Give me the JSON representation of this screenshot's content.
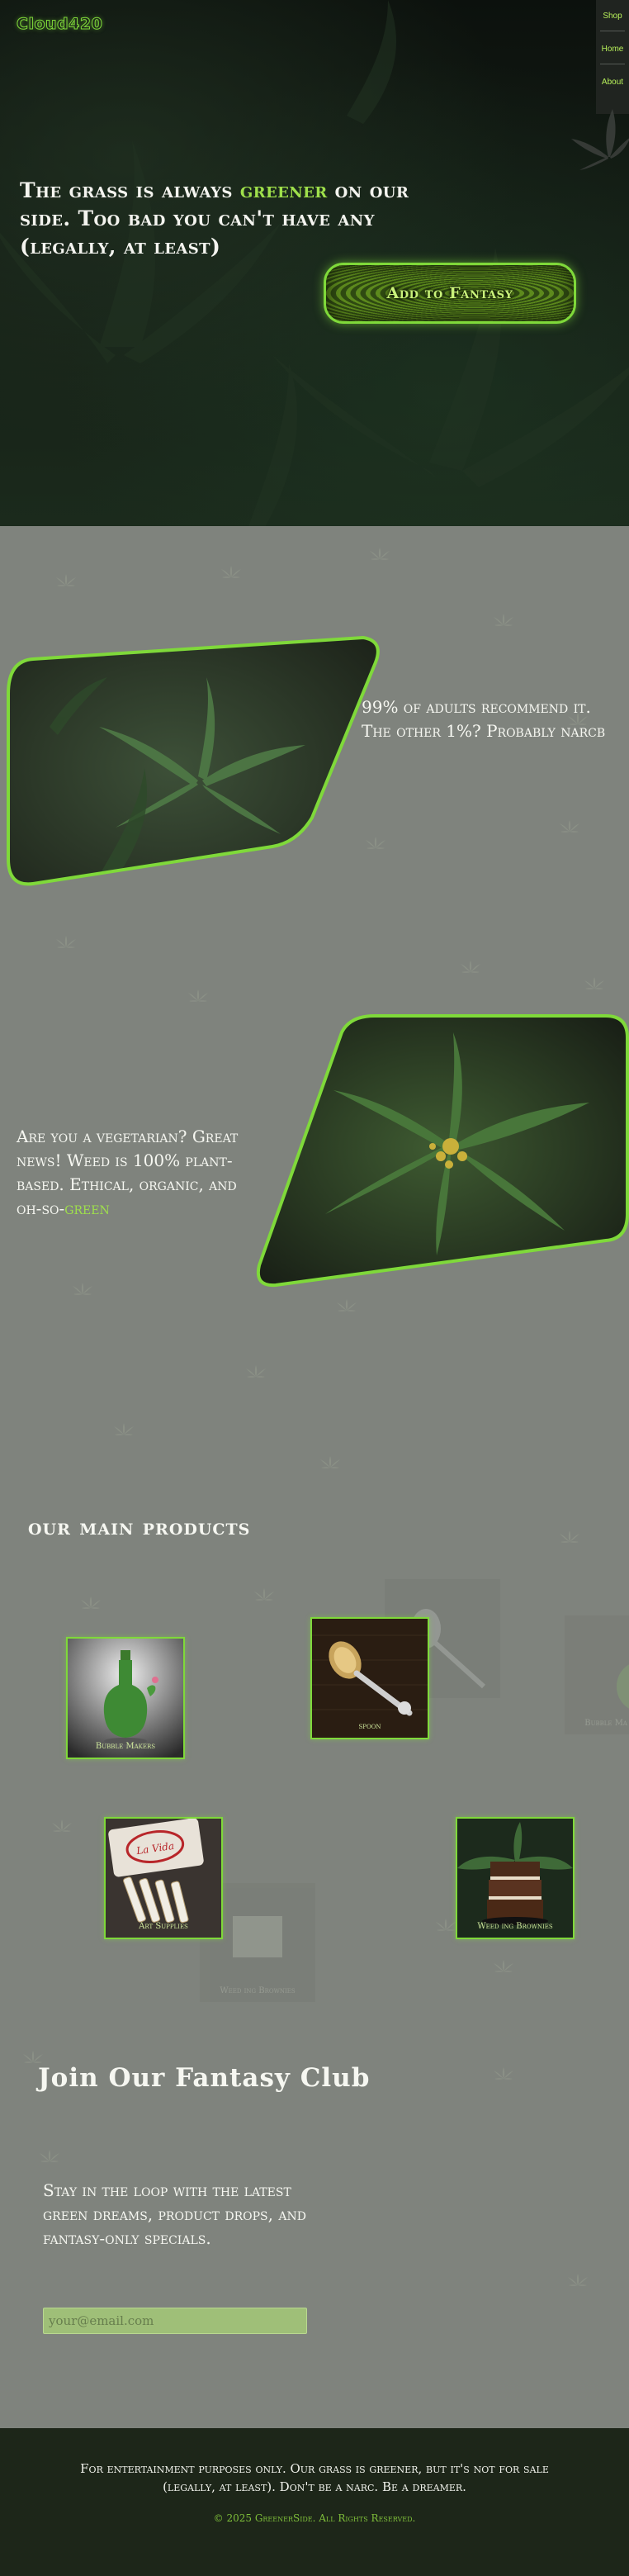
{
  "header": {
    "logo": "Cloud420",
    "nav": [
      "Shop",
      "Home",
      "About"
    ]
  },
  "hero": {
    "title_part1": "The grass is always ",
    "title_highlight": "greener",
    "title_part2": " on our side. Too bad you can't have any (legally, at least)",
    "cta_label": "Add to Fantasy"
  },
  "features": [
    {
      "text": "99% of adults recommend it. The other 1%? Probably narcb",
      "highlight": ""
    },
    {
      "text": "Are you a vegetarian? Great news! Weed is 100% plant-based. Ethical, organic, and oh-so-",
      "highlight": "green"
    }
  ],
  "products": {
    "title": "our main products",
    "items": [
      {
        "label": "Bubble Makers",
        "icon": "glass-bottle-icon"
      },
      {
        "label": "spoon",
        "icon": "spoon-icon"
      },
      {
        "label": "Art Supplies",
        "icon": "rolling-papers-icon"
      },
      {
        "label": "Weed ing Brownies",
        "icon": "brownie-icon"
      }
    ],
    "ghosts": [
      {
        "label": ""
      },
      {
        "label": "Bubble Ma"
      },
      {
        "label": "Weed ing Brownies"
      }
    ]
  },
  "club": {
    "title": "Join Our Fantasy Club",
    "text": "Stay in the loop with the latest green dreams, product drops, and fantasy-only specials.",
    "email_placeholder": "your@email.com"
  },
  "footer": {
    "text": "For entertainment purposes only. Our grass is greener, but it's not for sale (legally, at least). Don't be a narc. Be a dreamer.",
    "copyright": "© 2025 GreenerSide. All Rights Reserved."
  },
  "colors": {
    "accent": "#7fd93a",
    "highlight_text": "#9fe04b",
    "pattern_bg": "#7f837d",
    "footer_bg": "#1d2619"
  }
}
